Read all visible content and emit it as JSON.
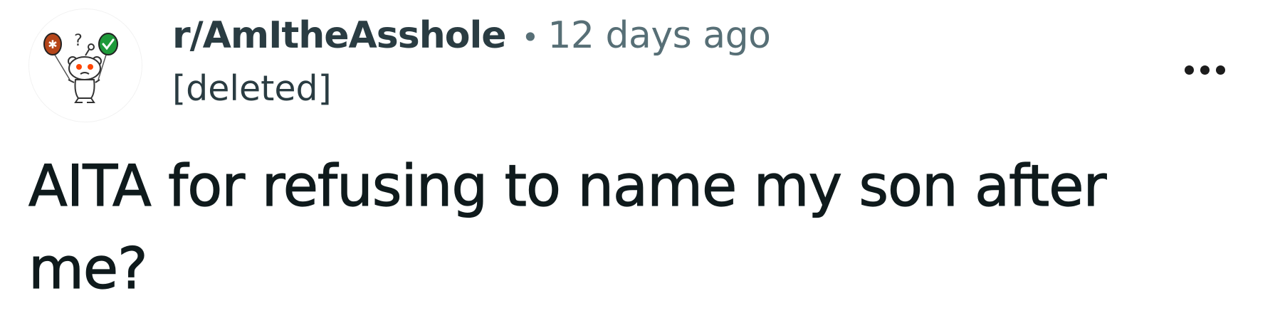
{
  "post": {
    "subreddit": "r/AmItheAsshole",
    "separator": "•",
    "time_ago": "12 days ago",
    "author": "[deleted]",
    "title": "AITA for refusing to name my son after me?"
  },
  "icons": {
    "avatar": "snoo-avatar-icon",
    "menu": "more-options-icon"
  },
  "colors": {
    "subreddit_text": "#2a3c42",
    "meta_text": "#576f76",
    "title_text": "#0f1a1c",
    "balloon_orange": "#b5461a",
    "balloon_green": "#1e9a3a",
    "snoo_eyes": "#ff4500"
  }
}
